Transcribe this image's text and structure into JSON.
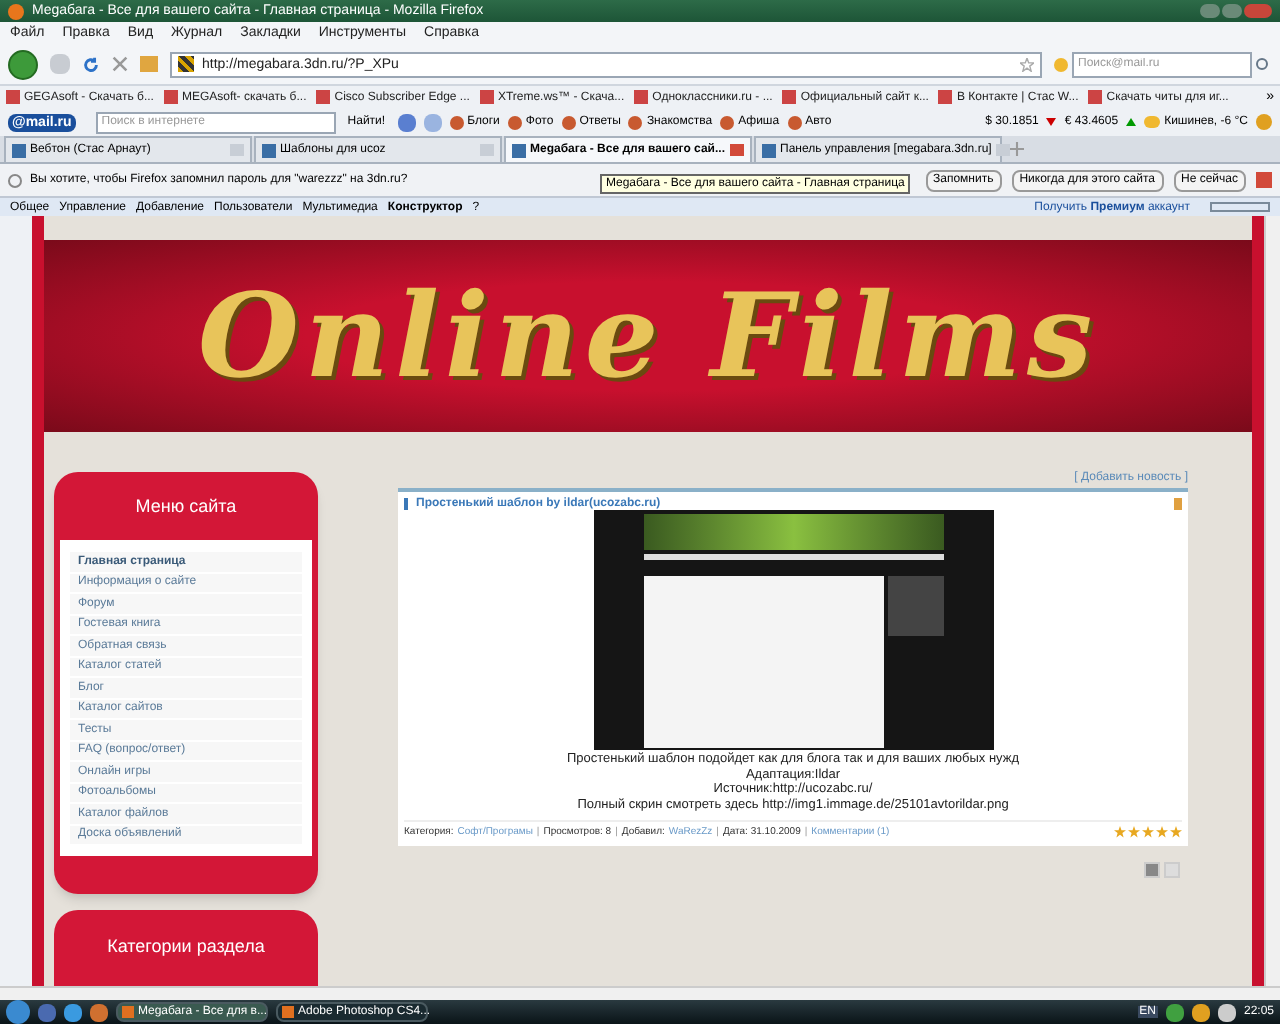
{
  "window": {
    "title": "Megaбага - Все для вашего сайта - Главная страница - Mozilla Firefox"
  },
  "menu": [
    "Файл",
    "Правка",
    "Вид",
    "Журнал",
    "Закладки",
    "Инструменты",
    "Справка"
  ],
  "address": "http://megabara.3dn.ru/?P_XPu",
  "search": {
    "placeholder": "Поиск@mail.ru"
  },
  "bookmarks": [
    "GEGAsoft - Скачать б...",
    "MEGAsoft- скачать б...",
    "Cisco Subscriber Edge ...",
    "XTreme.ws™ - Скача...",
    "Одноклассники.ru - ...",
    "Официальный сайт к...",
    "В Контакте | Стас W...",
    "Скачать читы для иг..."
  ],
  "bookmarks_more": "»",
  "mail_toolbar": {
    "logo": "@mail.ru",
    "search_placeholder": "Поиск в интернете",
    "find": "Найти!",
    "links": [
      "Блоги",
      "Фото",
      "Ответы",
      "Знакомства",
      "Афиша",
      "Авто"
    ],
    "usd": "$ 30.1851",
    "eur": "€ 43.4605",
    "weather": "Кишинев, -6 °C"
  },
  "tabs": [
    {
      "label": "Вебтон (Стас Арнаут)",
      "selected": false
    },
    {
      "label": "Шаблоны для ucoz",
      "selected": false
    },
    {
      "label": "Megaбага - Все для вашего сай...",
      "selected": true
    },
    {
      "label": "Панель управления [megabara.3dn.ru]",
      "selected": false
    }
  ],
  "notification": {
    "text": "Вы хотите, чтобы Firefox запомнил пароль для \"warezzz\" на 3dn.ru?",
    "buttons": [
      "Запомнить",
      "Никогда для этого сайта",
      "Не сейчас"
    ]
  },
  "tooltip": "Megaбага - Все для вашего сайта - Главная страница",
  "ucoz_bar": {
    "items": [
      {
        "label": "Общее",
        "active": false
      },
      {
        "label": "Управление",
        "active": false
      },
      {
        "label": "Добавление",
        "active": false
      },
      {
        "label": "Пользователи",
        "active": false
      },
      {
        "label": "Мультимедиа",
        "active": false
      },
      {
        "label": "Конструктор",
        "active": true
      }
    ],
    "help": "?",
    "premium": "Получить **Премиум** аккаунт"
  },
  "site": {
    "logo": "Online Films",
    "menu_title": "Меню сайта",
    "menu": [
      {
        "label": "Главная страница",
        "selected": true
      },
      {
        "label": "Информация о сайте",
        "selected": false
      },
      {
        "label": "Форум",
        "selected": false
      },
      {
        "label": "Гостевая книга",
        "selected": false
      },
      {
        "label": "Обратная связь",
        "selected": false
      },
      {
        "label": "Каталог статей",
        "selected": false
      },
      {
        "label": "Блог",
        "selected": false
      },
      {
        "label": "Каталог сайтов",
        "selected": false
      },
      {
        "label": "Тесты",
        "selected": false
      },
      {
        "label": "FAQ (вопрос/ответ)",
        "selected": false
      },
      {
        "label": "Онлайн игры",
        "selected": false
      },
      {
        "label": "Фотоальбомы",
        "selected": false
      },
      {
        "label": "Каталог файлов",
        "selected": false
      },
      {
        "label": "Доска объявлений",
        "selected": false
      }
    ],
    "categories_title": "Категории раздела",
    "add_news": "[ Добавить новость ]",
    "post": {
      "title": "Простенький шаблон by ildar(ucozabc.ru)",
      "lines": [
        "Простенький шаблон подойдет как для блога так и для ваших любых нужд",
        "Адаптация:Ildar",
        "Источник:http://ucozabc.ru/",
        "Полный скрин смотреть здесь http://img1.immage.de/25101avtorildar.png"
      ],
      "meta": [
        {
          "text": "Категория:",
          "kind": "label"
        },
        {
          "text": "Софт/Програмы",
          "kind": "link"
        },
        {
          "text": "|",
          "kind": "sep"
        },
        {
          "text": "Просмотров: 8",
          "kind": "label"
        },
        {
          "text": "|",
          "kind": "sep"
        },
        {
          "text": "Добавил:",
          "kind": "label"
        },
        {
          "text": "WaRezZz",
          "kind": "link"
        },
        {
          "text": "|",
          "kind": "sep"
        },
        {
          "text": "Дата: 31.10.2009",
          "kind": "label"
        },
        {
          "text": "|",
          "kind": "sep"
        },
        {
          "text": "Комментарии (1)",
          "kind": "link"
        }
      ],
      "stars": 5
    }
  },
  "taskbar": {
    "items": [
      {
        "label": "Megaбага - Все для в...",
        "selected": true
      },
      {
        "label": "Adobe Photoshop CS4...",
        "selected": false
      }
    ],
    "lang": "EN",
    "clock": "22:05"
  }
}
